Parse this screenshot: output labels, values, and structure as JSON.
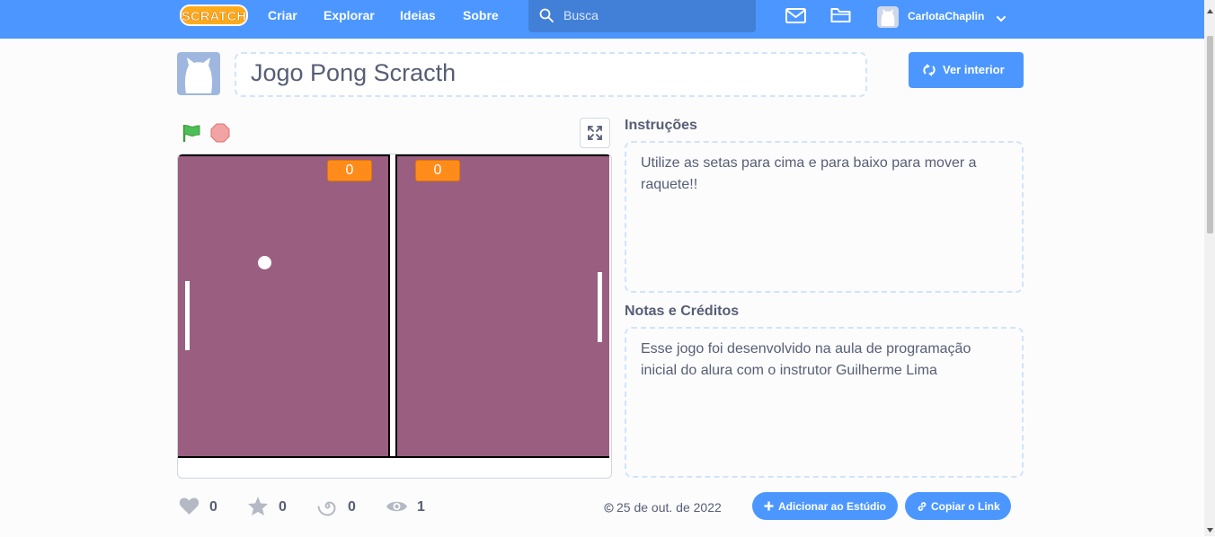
{
  "nav": {
    "logo_text": "SCRATCH",
    "links": [
      "Criar",
      "Explorar",
      "Ideias",
      "Sobre"
    ],
    "search_placeholder": "Busca",
    "user": "CarlotaChaplin"
  },
  "project": {
    "title": "Jogo Pong Scracth",
    "see_inside": "Ver interior"
  },
  "stage": {
    "score_left": "0",
    "score_right": "0"
  },
  "instructions": {
    "heading": "Instruções",
    "text_line1": "Utilize as setas para cima e para baixo para mover a",
    "text_line2": "raquete!!"
  },
  "notes": {
    "heading": "Notas e Créditos",
    "text_line1": "Esse jogo foi desenvolvido na aula de programação",
    "text_line2": "inicial do alura com o instrutor Guilherme Lima"
  },
  "stats": {
    "loves": "0",
    "favorites": "0",
    "remixes": "0",
    "views": "1",
    "date": "25 de out. de 2022"
  },
  "actions": {
    "add_to_studio": "Adicionar ao Estúdio",
    "copy_link": "Copiar o Link"
  },
  "icons": {
    "green_flag": "green-flag-icon",
    "stop": "stop-icon",
    "fullscreen": "fullscreen-icon",
    "messages": "mail-icon",
    "my_stuff": "folder-icon"
  },
  "colors": {
    "brand_blue": "#4c97ff",
    "stage_bg": "#9a5e80",
    "score_orange": "#ff8c1a"
  }
}
